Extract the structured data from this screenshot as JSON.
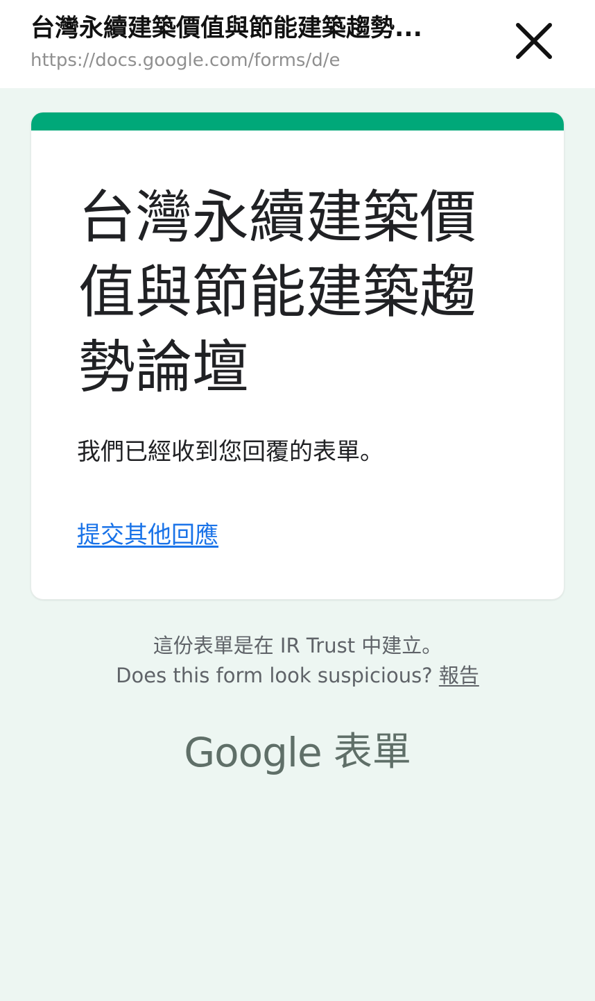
{
  "browser": {
    "title": "台灣永續建築價值與節能建築趨勢...",
    "url": "https://docs.google.com/forms/d/e",
    "close_icon": "close-icon"
  },
  "form": {
    "title": "台灣永續建築價值與節能建築趨勢論壇",
    "message": "我們已經收到您回覆的表單。",
    "submit_another_label": "提交其他回應"
  },
  "footer": {
    "created_in": "這份表單是在 IR Trust 中建立。",
    "suspicious_text": "Does this form look suspicious?",
    "report_label": "報告",
    "brand_google": "Google",
    "brand_forms": "表單"
  },
  "colors": {
    "accent": "#00a879",
    "link": "#1a73e8",
    "background": "#edf6f2"
  }
}
